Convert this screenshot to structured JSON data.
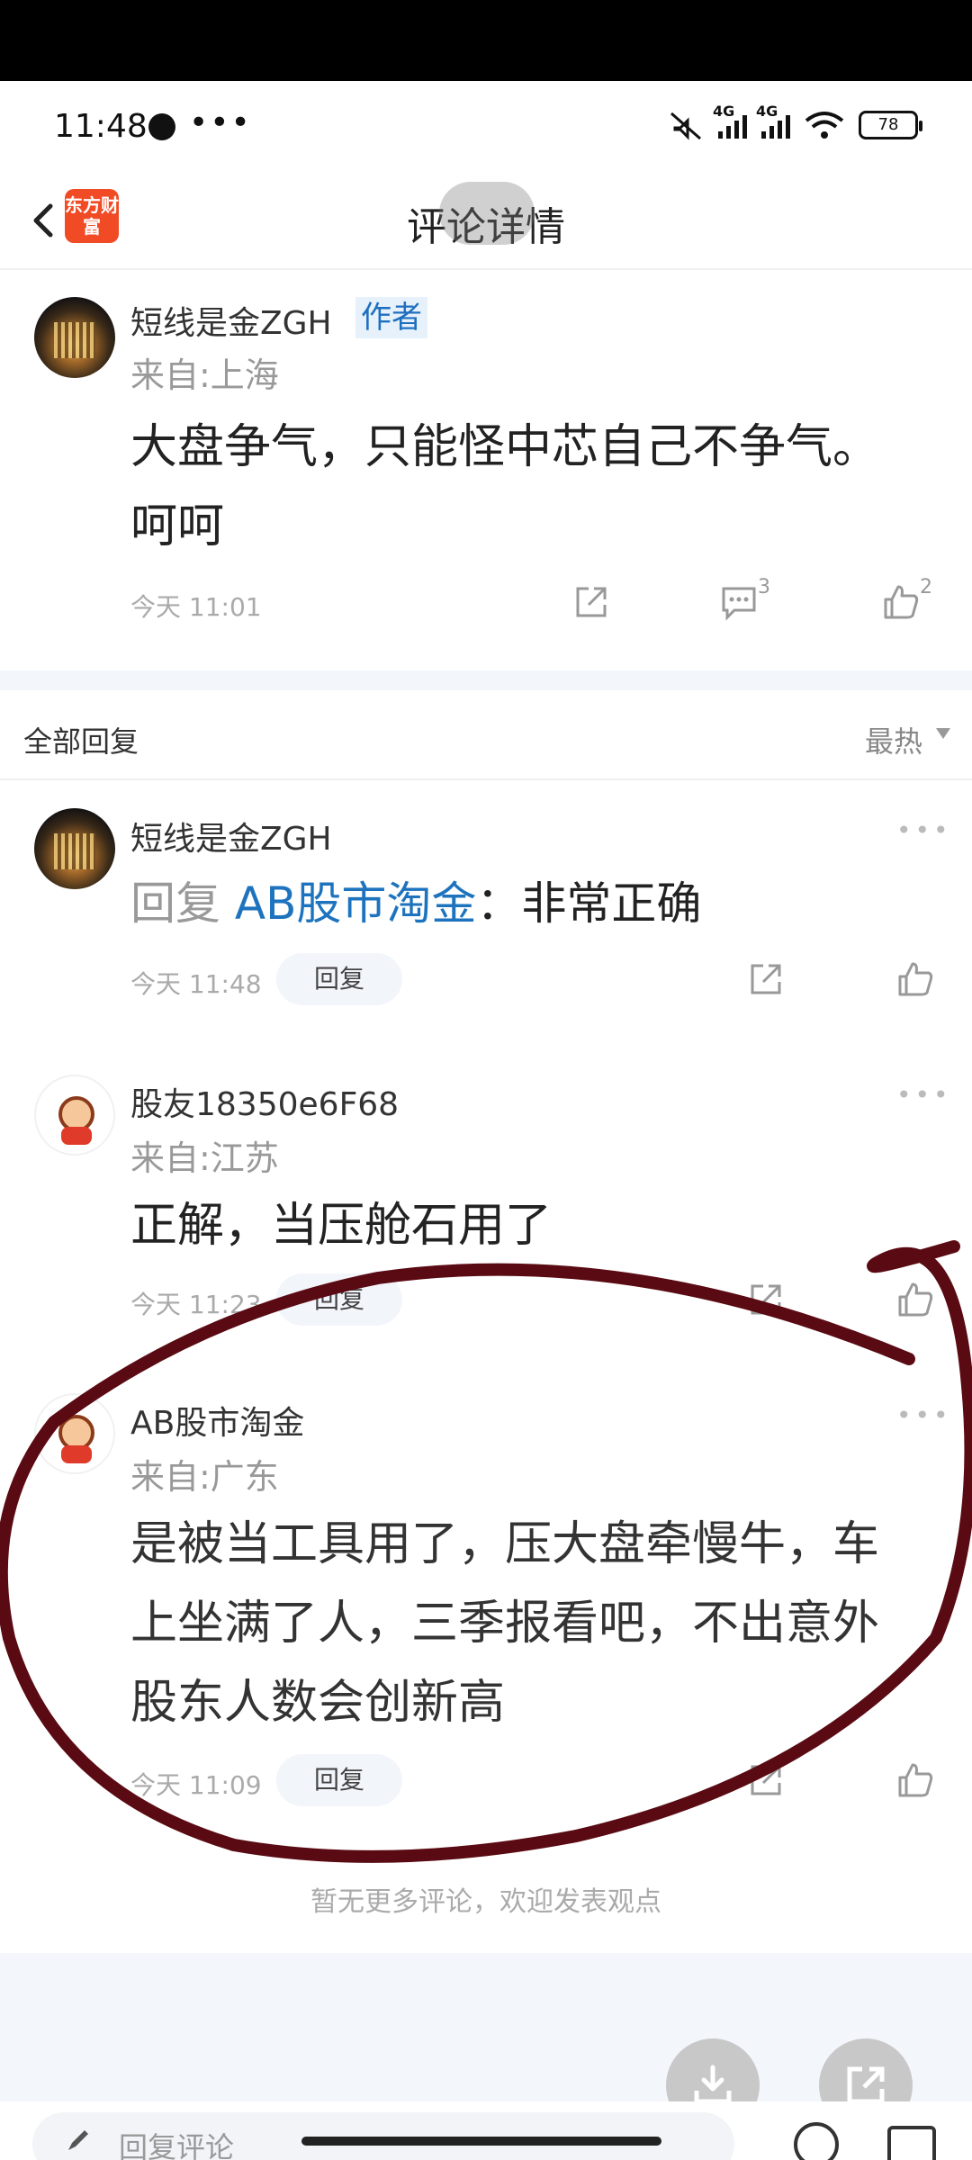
{
  "status_bar": {
    "time": "11:48",
    "dots": "•••",
    "net1": "4G",
    "net2": "4G",
    "battery": "78"
  },
  "nav": {
    "title": "评论详情",
    "logo_text": "东方财富"
  },
  "main_comment": {
    "username": "短线是金ZGH",
    "author_badge": "作者",
    "from": "来自:上海",
    "content_line1": "大盘争气，只能怪中芯自己不争气。",
    "content_line2": "呵呵",
    "time": "今天 11:01",
    "comment_count": "3",
    "like_count": "2"
  },
  "section": {
    "title": "全部回复",
    "sort": "最热"
  },
  "replies": [
    {
      "username": "短线是金ZGH",
      "reply_prefix": "回复 ",
      "reply_to": "AB股市淘金",
      "reply_text": "：非常正确",
      "time": "今天 11:48",
      "reply_button": "回复"
    },
    {
      "username": "股友18350e6F68",
      "from": "来自:江苏",
      "content": "正解，当压舱石用了",
      "time": "今天 11:23",
      "reply_button": "回复"
    },
    {
      "username": "AB股市淘金",
      "from": "来自:广东",
      "content_line1": "是被当工具用了，压大盘牵慢牛，车",
      "content_line2": "上坐满了人，三季报看吧，不出意外",
      "content_line3": "股东人数会创新高",
      "time": "今天 11:09",
      "reply_button": "回复"
    }
  ],
  "footer": {
    "no_more": "暂无更多评论，欢迎发表观点",
    "input_placeholder": "回复评论"
  },
  "colors": {
    "link": "#1e73be",
    "annotation": "#5a0a12",
    "logo": "#f04b25"
  }
}
